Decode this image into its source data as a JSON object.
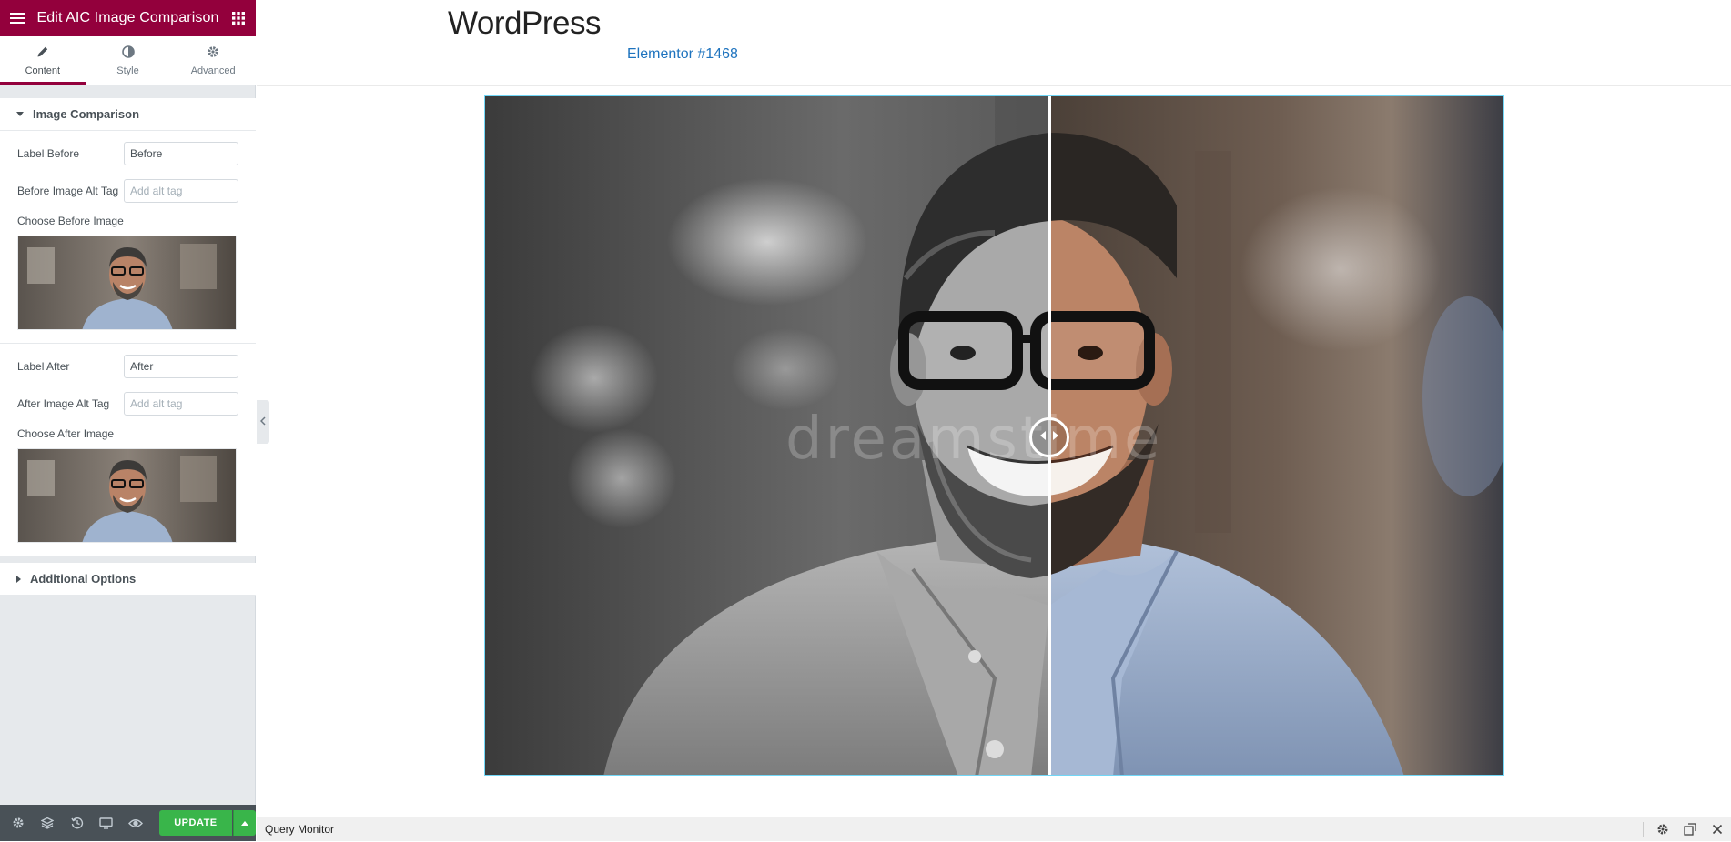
{
  "panel": {
    "title": "Edit AIC Image Comparison",
    "tabs": [
      {
        "label": "Content",
        "icon": "pencil-icon"
      },
      {
        "label": "Style",
        "icon": "half-circle-icon"
      },
      {
        "label": "Advanced",
        "icon": "gear-icon"
      }
    ],
    "sections": {
      "image_comparison": {
        "title": "Image Comparison",
        "label_before": {
          "label": "Label Before",
          "value": "Before"
        },
        "before_alt": {
          "label": "Before Image Alt Tag",
          "placeholder": "Add alt tag"
        },
        "choose_before": {
          "label": "Choose Before Image"
        },
        "label_after": {
          "label": "Label After",
          "value": "After"
        },
        "after_alt": {
          "label": "After Image Alt Tag",
          "placeholder": "Add alt tag"
        },
        "choose_after": {
          "label": "Choose After Image"
        }
      },
      "additional_options": {
        "title": "Additional Options"
      }
    },
    "footer": {
      "icons": [
        "settings-icon",
        "layers-icon",
        "history-icon",
        "responsive-icon",
        "preview-eye-icon"
      ],
      "update_label": "UPDATE"
    }
  },
  "site": {
    "title": "WordPress",
    "link": "Elementor #1468"
  },
  "comparison": {
    "watermark": "dreamstime",
    "slider_position_percent": 55
  },
  "query_monitor": {
    "label": "Query Monitor"
  },
  "colors": {
    "brand": "#93003c",
    "update_green": "#39b54a",
    "link_blue": "#1e73be",
    "frame_cyan": "#71d7f7"
  }
}
